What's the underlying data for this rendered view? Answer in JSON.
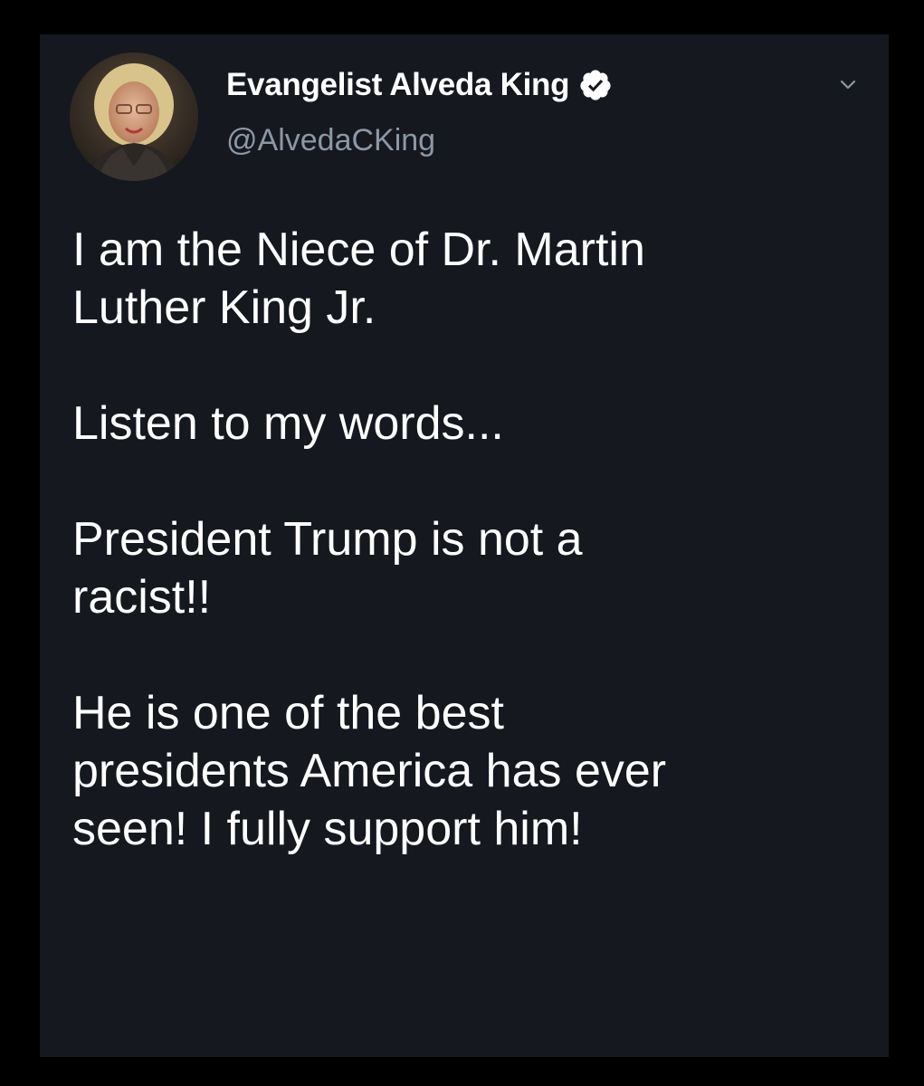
{
  "tweet": {
    "author": {
      "display_name": "Evangelist Alveda King",
      "handle": "@AlvedaCKing",
      "verified": true,
      "avatar_icon": "profile-photo"
    },
    "menu_icon": "chevron-down-icon",
    "text": {
      "p1": [
        "I am the Niece of Dr. Martin",
        "Luther King Jr."
      ],
      "p2": [
        "Listen to my words..."
      ],
      "p3": [
        "President Trump is not a",
        "racist!!"
      ],
      "p4": [
        "He is one of the best",
        "presidents America has ever",
        "seen! I fully support him!"
      ]
    }
  },
  "colors": {
    "background": "#000000",
    "card": "#15181f",
    "text": "#ffffff",
    "secondary_text": "#8b98a5",
    "verified_badge": "#ffffff"
  }
}
